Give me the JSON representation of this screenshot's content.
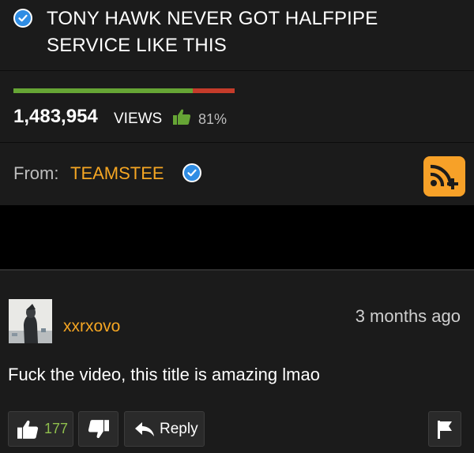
{
  "video": {
    "title": "TONY HAWK NEVER GOT HALFPIPE SERVICE LIKE THIS",
    "views_count": "1,483,954",
    "views_label": "VIEWS",
    "rating_percent": "81%",
    "rating_fraction": 0.81,
    "from_label": "From:",
    "channel_name": "TEAMSTEE"
  },
  "comment": {
    "username": "xxrxovo",
    "timestamp": "3 months ago",
    "text": "Fuck the video, this title is amazing lmao",
    "upvotes": "177",
    "reply_label": "Reply"
  },
  "colors": {
    "accent": "#f5a623",
    "like_green": "#66a535",
    "dislike_red": "#c53b2a",
    "verified_blue": "#2f8de4",
    "card_bg": "#1b1b1b"
  }
}
